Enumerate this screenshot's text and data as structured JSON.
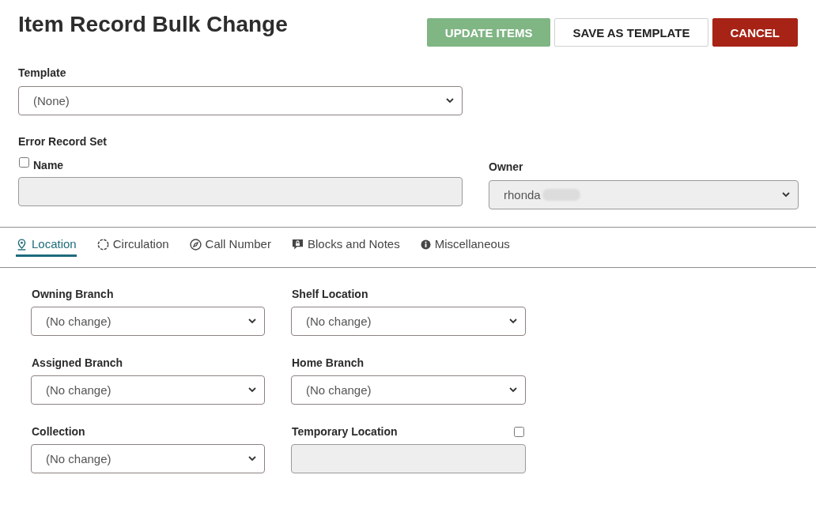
{
  "header": {
    "title": "Item Record Bulk Change",
    "buttons": [
      {
        "label": "UPDATE ITEMS",
        "kind": "primary"
      },
      {
        "label": "SAVE AS TEMPLATE",
        "kind": "secondary"
      },
      {
        "label": "CANCEL",
        "kind": "danger"
      }
    ]
  },
  "template": {
    "label": "Template",
    "value": "(None)"
  },
  "error_record_set": {
    "title": "Error Record Set",
    "name": {
      "label": "Name",
      "checked": false,
      "disabled": true
    },
    "owner": {
      "label": "Owner",
      "value": "rhonda",
      "redacted": true,
      "disabled": true
    }
  },
  "tabs": [
    {
      "label": "Location",
      "selected": true
    },
    {
      "label": "Circulation",
      "selected": false
    },
    {
      "label": "Call Number",
      "selected": false
    },
    {
      "label": "Blocks and Notes",
      "selected": false
    },
    {
      "label": "Miscellaneous",
      "selected": false
    }
  ],
  "location_fields": [
    {
      "label": "Owning Branch",
      "kind": "select",
      "value": "(No change)",
      "disabled": false
    },
    {
      "label": "Shelf Location",
      "kind": "select",
      "value": "(No change)",
      "disabled": false
    },
    {
      "label": "Assigned Branch",
      "kind": "select",
      "value": "(No change)",
      "disabled": false
    },
    {
      "label": "Home Branch",
      "kind": "select",
      "value": "(No change)",
      "disabled": false
    },
    {
      "label": "Collection",
      "kind": "select",
      "value": "(No change)",
      "disabled": false
    },
    {
      "label": "Temporary Location",
      "kind": "text",
      "checked": false,
      "disabled": true
    }
  ]
}
